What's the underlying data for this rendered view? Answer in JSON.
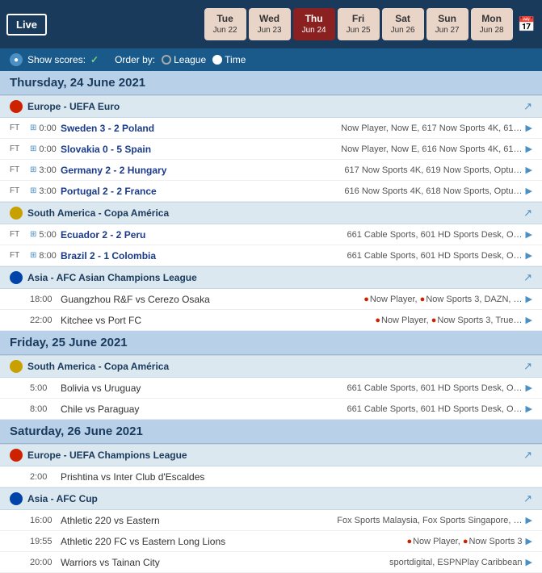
{
  "header": {
    "live_label": "Live",
    "days": [
      {
        "name": "Tue",
        "date": "Jun 22",
        "active": false
      },
      {
        "name": "Wed",
        "date": "Jun 23",
        "active": false
      },
      {
        "name": "Thu",
        "date": "Jun 24",
        "active": true
      },
      {
        "name": "Fri",
        "date": "Jun 25",
        "active": false
      },
      {
        "name": "Sat",
        "date": "Jun 26",
        "active": false
      },
      {
        "name": "Sun",
        "date": "Jun 27",
        "active": false
      },
      {
        "name": "Mon",
        "date": "Jun 28",
        "active": false
      }
    ]
  },
  "controls": {
    "show_scores_label": "Show scores:",
    "order_by_label": "Order by:",
    "league_label": "League",
    "time_label": "Time"
  },
  "sections": [
    {
      "day": "Thursday, 24 June 2021",
      "leagues": [
        {
          "name": "Europe - UEFA Euro",
          "icon_type": "red",
          "matches": [
            {
              "status": "FT",
              "time": "0:00",
              "teams": "Sweden 3 - 2 Poland",
              "channels": "Now Player, Now E, 617 Now Sports 4K, 61…",
              "bold": true
            },
            {
              "status": "FT",
              "time": "0:00",
              "teams": "Slovakia 0 - 5 Spain",
              "channels": "Now Player, Now E, 616 Now Sports 4K, 61…",
              "bold": true
            },
            {
              "status": "FT",
              "time": "3:00",
              "teams": "Germany 2 - 2 Hungary",
              "channels": "617 Now Sports 4K, 619 Now Sports, Optu…",
              "bold": true
            },
            {
              "status": "FT",
              "time": "3:00",
              "teams": "Portugal 2 - 2 France",
              "channels": "616 Now Sports 4K, 618 Now Sports, Optu…",
              "bold": true
            }
          ]
        },
        {
          "name": "South America - Copa América",
          "icon_type": "yellow",
          "matches": [
            {
              "status": "FT",
              "time": "5:00",
              "teams": "Ecuador 2 - 2 Peru",
              "channels": "661 Cable Sports, 601 HD Sports Desk, O…",
              "bold": true
            },
            {
              "status": "FT",
              "time": "8:00",
              "teams": "Brazil 2 - 1 Colombia",
              "channels": "661 Cable Sports, 601 HD Sports Desk, O…",
              "bold": true
            }
          ]
        },
        {
          "name": "Asia - AFC Asian Champions League",
          "icon_type": "blue",
          "matches": [
            {
              "status": "",
              "time": "18:00",
              "teams": "Guangzhou R&F vs Cerezo Osaka",
              "channels": "🔴Now Player, 🔴Now Sports 3, DAZN, …",
              "bold": false,
              "red_channels": true
            },
            {
              "status": "",
              "time": "22:00",
              "teams": "Kitchee vs Port FC",
              "channels": "🔴Now Player, 🔴Now Sports 3, True…",
              "bold": false,
              "red_channels": true
            }
          ]
        }
      ]
    },
    {
      "day": "Friday, 25 June 2021",
      "leagues": [
        {
          "name": "South America - Copa América",
          "icon_type": "yellow",
          "matches": [
            {
              "status": "",
              "time": "5:00",
              "teams": "Bolivia vs Uruguay",
              "channels": "661 Cable Sports, 601 HD Sports Desk, O…",
              "bold": false
            },
            {
              "status": "",
              "time": "8:00",
              "teams": "Chile vs Paraguay",
              "channels": "661 Cable Sports, 601 HD Sports Desk, O…",
              "bold": false
            }
          ]
        }
      ]
    },
    {
      "day": "Saturday, 26 June 2021",
      "leagues": [
        {
          "name": "Europe - UEFA Champions League",
          "icon_type": "red",
          "matches": [
            {
              "status": "",
              "time": "2:00",
              "teams": "Prishtina vs Inter Club d'Escaldes",
              "channels": "",
              "bold": false
            }
          ]
        },
        {
          "name": "Asia - AFC Cup",
          "icon_type": "blue",
          "matches": [
            {
              "status": "",
              "time": "16:00",
              "teams": "Athletic 220 vs Eastern",
              "channels": "Fox Sports Malaysia, Fox Sports Singapore, …",
              "bold": false
            },
            {
              "status": "",
              "time": "19:55",
              "teams": "Athletic 220 FC vs Eastern Long Lions",
              "channels": "🔴Now Player, 🔴Now Sports 3",
              "bold": false,
              "red_channels": true
            },
            {
              "status": "",
              "time": "20:00",
              "teams": "Warriors vs Tainan City",
              "channels": "sportdigital, ESPNPlay Caribbean",
              "bold": false
            }
          ]
        }
      ]
    }
  ]
}
